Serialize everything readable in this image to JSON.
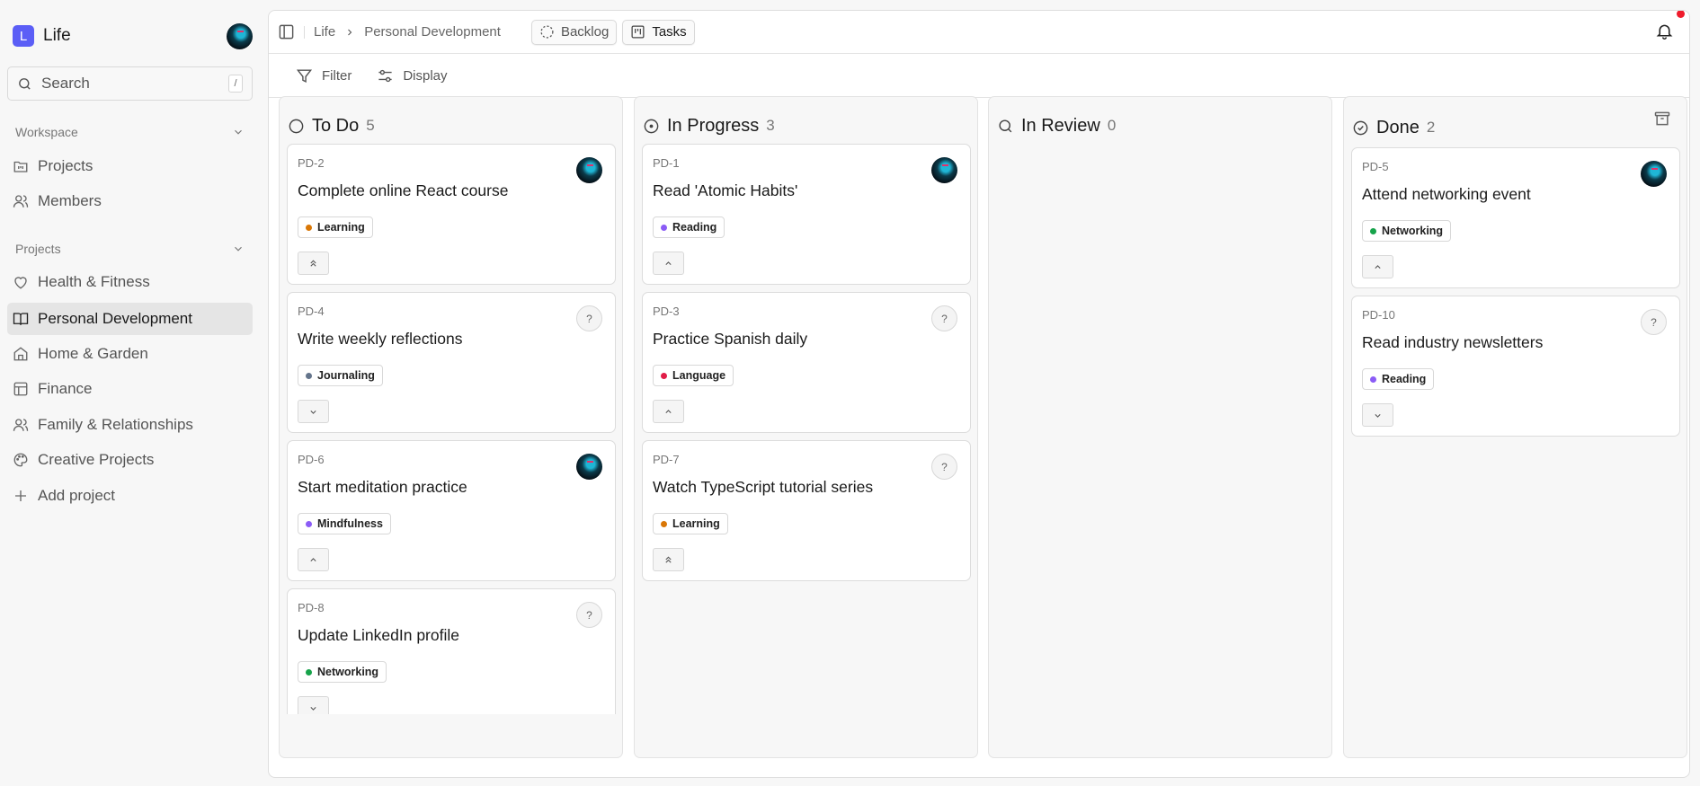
{
  "sidebar": {
    "logo_letter": "L",
    "workspace_name": "Life",
    "search": {
      "placeholder": "Search",
      "shortcut": "/"
    },
    "workspace_section": "Workspace",
    "workspace_items": [
      {
        "label": "Projects",
        "icon": "projects-icon"
      },
      {
        "label": "Members",
        "icon": "members-icon"
      }
    ],
    "projects_section": "Projects",
    "projects": [
      {
        "label": "Health & Fitness",
        "icon": "heart-icon"
      },
      {
        "label": "Personal Development",
        "icon": "book-icon",
        "active": true
      },
      {
        "label": "Home & Garden",
        "icon": "home-icon"
      },
      {
        "label": "Finance",
        "icon": "table-icon"
      },
      {
        "label": "Family & Relationships",
        "icon": "users-icon"
      },
      {
        "label": "Creative Projects",
        "icon": "palette-icon"
      }
    ],
    "add_project": "Add project"
  },
  "header": {
    "breadcrumb": [
      "Life",
      "Personal Development"
    ],
    "views": [
      {
        "label": "Backlog"
      },
      {
        "label": "Tasks",
        "active": true
      }
    ]
  },
  "toolbar": {
    "filter": "Filter",
    "display": "Display"
  },
  "columns": [
    {
      "title": "To Do",
      "count": "5",
      "cards": [
        {
          "id": "PD-2",
          "title": "Complete online React course",
          "tag": "Learning",
          "tag_color": "#d97706",
          "priority": "urgent",
          "assigned": true
        },
        {
          "id": "PD-4",
          "title": "Write weekly reflections",
          "tag": "Journaling",
          "tag_color": "#64748b",
          "priority": "low",
          "assigned": false
        },
        {
          "id": "PD-6",
          "title": "Start meditation practice",
          "tag": "Mindfulness",
          "tag_color": "#8b5cf6",
          "priority": "medium",
          "assigned": true
        },
        {
          "id": "PD-8",
          "title": "Update LinkedIn profile",
          "tag": "Networking",
          "tag_color": "#16a34a",
          "priority": "low",
          "assigned": false
        }
      ]
    },
    {
      "title": "In Progress",
      "count": "3",
      "cards": [
        {
          "id": "PD-1",
          "title": "Read 'Atomic Habits'",
          "tag": "Reading",
          "tag_color": "#8b5cf6",
          "priority": "medium",
          "assigned": true
        },
        {
          "id": "PD-3",
          "title": "Practice Spanish daily",
          "tag": "Language",
          "tag_color": "#e11d48",
          "priority": "medium",
          "assigned": false
        },
        {
          "id": "PD-7",
          "title": "Watch TypeScript tutorial series",
          "tag": "Learning",
          "tag_color": "#d97706",
          "priority": "urgent",
          "assigned": false
        }
      ]
    },
    {
      "title": "In Review",
      "count": "0",
      "cards": []
    },
    {
      "title": "Done",
      "count": "2",
      "cards": [
        {
          "id": "PD-5",
          "title": "Attend networking event",
          "tag": "Networking",
          "tag_color": "#16a34a",
          "priority": "medium",
          "assigned": true
        },
        {
          "id": "PD-10",
          "title": "Read industry newsletters",
          "tag": "Reading",
          "tag_color": "#8b5cf6",
          "priority": "low",
          "assigned": false
        }
      ]
    }
  ],
  "unassigned_glyph": "?"
}
